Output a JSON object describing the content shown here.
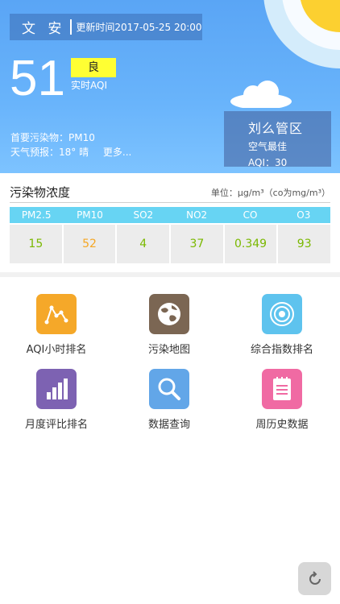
{
  "header": {
    "city": "文 安",
    "update_time": "更新时间2017-05-25 20:00",
    "aqi_value": "51",
    "aqi_level": "良",
    "aqi_caption": "实时AQI",
    "primary_pollutant": "首要污染物：PM10",
    "forecast": "天气预报：18° 晴",
    "more_link": "更多...",
    "station": {
      "name": "刘么管区",
      "status": "空气最佳",
      "aqi": "AQI：30"
    }
  },
  "concentration": {
    "title": "污染物浓度",
    "unit": "单位：μg/m³（co为mg/m³）",
    "columns": [
      "PM2.5",
      "PM10",
      "SO2",
      "NO2",
      "CO",
      "O3"
    ],
    "values": [
      "15",
      "52",
      "4",
      "37",
      "0.349",
      "93"
    ],
    "value_colors": [
      "#7ab800",
      "#f5a623",
      "#7ab800",
      "#7ab800",
      "#7ab800",
      "#7ab800"
    ]
  },
  "menu": {
    "items": [
      {
        "label": "AQI小时排名",
        "icon": "line-graph-icon",
        "color": "#f5a829"
      },
      {
        "label": "污染地图",
        "icon": "globe-icon",
        "color": "#7b6653"
      },
      {
        "label": "综合指数排名",
        "icon": "target-icon",
        "color": "#5ec3ee"
      },
      {
        "label": "月度评比排名",
        "icon": "bar-chart-icon",
        "color": "#7d62b2"
      },
      {
        "label": "数据查询",
        "icon": "search-icon",
        "color": "#62a6e8"
      },
      {
        "label": "周历史数据",
        "icon": "document-icon",
        "color": "#f06aa3"
      }
    ]
  },
  "colors": {
    "header_blue": "#5aa5f5",
    "table_header": "#67d4f3",
    "good_badge": "#ffff33"
  }
}
